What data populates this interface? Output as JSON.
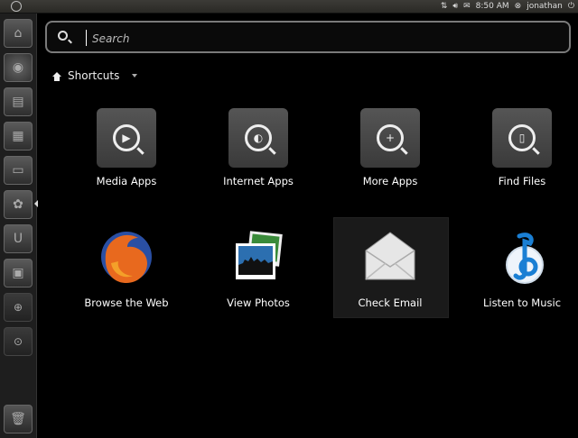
{
  "top_panel": {
    "time": "8:50 AM",
    "user": "jonathan"
  },
  "search": {
    "placeholder": "Search"
  },
  "filter": {
    "label": "Shortcuts"
  },
  "shortcuts": [
    {
      "label": "Media Apps"
    },
    {
      "label": "Internet Apps"
    },
    {
      "label": "More Apps"
    },
    {
      "label": "Find Files"
    }
  ],
  "apps": [
    {
      "label": "Browse the Web"
    },
    {
      "label": "View Photos"
    },
    {
      "label": "Check Email"
    },
    {
      "label": "Listen to Music"
    }
  ],
  "icons": {
    "launcher": [
      "home-folder-icon",
      "firefox-icon",
      "writer-icon",
      "calc-icon",
      "impress-icon",
      "software-center-icon",
      "ubuntu-one-icon",
      "workspaces-icon",
      "apps-lens-icon",
      "files-lens-icon",
      "trash-icon"
    ]
  }
}
